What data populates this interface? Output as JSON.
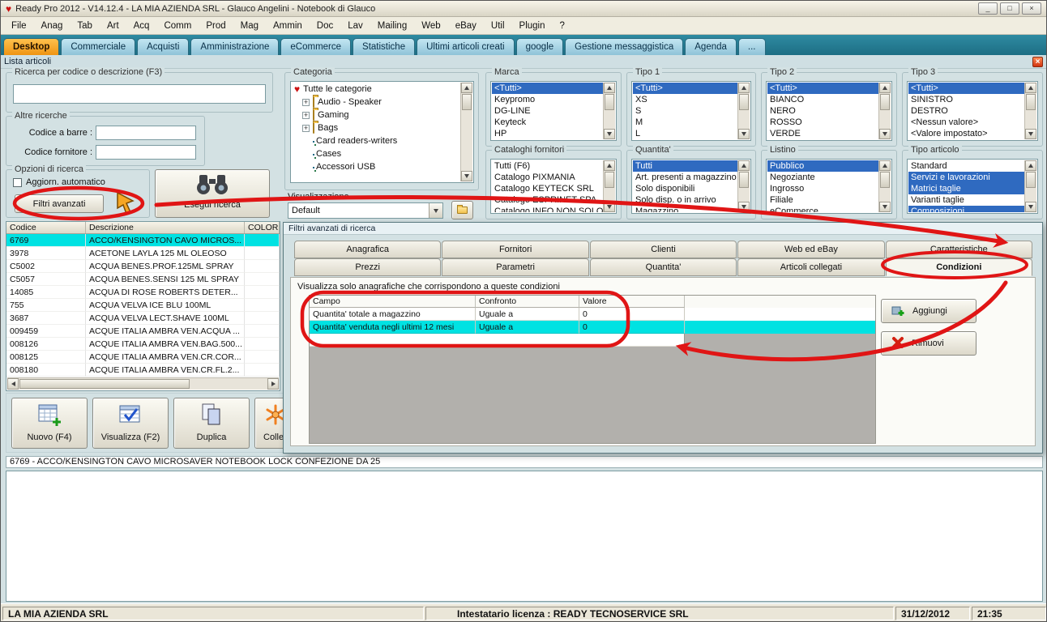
{
  "window": {
    "title": "Ready Pro 2012 - V14.12.4 - LA MIA AZIENDA SRL - Glauco Angelini - Notebook di Glauco"
  },
  "icons": {
    "heart": "♥",
    "minimize": "_",
    "restore": "□",
    "close": "×",
    "plus": "+"
  },
  "colors": {
    "accent_orange": "#ef9413",
    "selection_blue": "#2f6ac0",
    "highlight_cyan": "#00e2e2",
    "annotation_red": "#e01515"
  },
  "menubar": {
    "items": [
      "File",
      "Anag",
      "Tab",
      "Art",
      "Acq",
      "Comm",
      "Prod",
      "Mag",
      "Ammin",
      "Doc",
      "Lav",
      "Mailing",
      "Web",
      "eBay",
      "Util",
      "Plugin",
      "?"
    ]
  },
  "tabbar": {
    "tabs": [
      {
        "label": "Desktop",
        "active": true
      },
      {
        "label": "Commerciale"
      },
      {
        "label": "Acquisti"
      },
      {
        "label": "Amministrazione"
      },
      {
        "label": "eCommerce"
      },
      {
        "label": "Statistiche"
      },
      {
        "label": "Ultimi articoli creati"
      },
      {
        "label": "google"
      },
      {
        "label": "Gestione messaggistica"
      },
      {
        "label": "Agenda"
      },
      {
        "label": "..."
      }
    ]
  },
  "lista_bar": {
    "title": "Lista articoli"
  },
  "search": {
    "group_title": "Ricerca per codice o descrizione (F3)",
    "value": "",
    "altre_title": "Altre ricerche",
    "barcode_label": "Codice a barre :",
    "barcode_value": "",
    "supplier_label": "Codice fornitore :",
    "supplier_value": "",
    "opzioni_title": "Opzioni di ricerca",
    "auto_check_label": "Aggiorn. automatico",
    "filtri_button": "Filtri avanzati",
    "esegui_button": "Esegui ricerca"
  },
  "categoria": {
    "title": "Categoria",
    "items": [
      {
        "label": "Tutte le categorie",
        "icon": "heart",
        "indent": 0
      },
      {
        "label": "Audio - Speaker",
        "icon": "folder",
        "expand": true,
        "indent": 1
      },
      {
        "label": "Gaming",
        "icon": "folder",
        "expand": true,
        "indent": 1
      },
      {
        "label": "Bags",
        "icon": "folder",
        "expand": true,
        "indent": 1
      },
      {
        "label": "Card readers-writers",
        "icon": "cards",
        "indent": 1
      },
      {
        "label": "Cases",
        "icon": "cards",
        "indent": 1
      },
      {
        "label": "Accessori USB",
        "icon": "cards",
        "indent": 1
      }
    ],
    "visualizzazione_label": "Visualizzazione",
    "visualizzazione_value": "Default"
  },
  "lists": {
    "marca": {
      "title": "Marca",
      "items": [
        {
          "label": "<Tutti>",
          "selected": true
        },
        {
          "label": "Keypromo"
        },
        {
          "label": "DG-LINE"
        },
        {
          "label": "Keyteck"
        },
        {
          "label": "HP"
        }
      ]
    },
    "cataloghi": {
      "title": "Cataloghi fornitori",
      "items": [
        {
          "label": "Tutti (F6)"
        },
        {
          "label": "Catalogo PIXMANIA"
        },
        {
          "label": "Catalogo KEYTECK SRL"
        },
        {
          "label": "Catalogo ESPRINET SPA"
        },
        {
          "label": "Catalogo INFO NON SOLO"
        }
      ]
    },
    "tipo1": {
      "title": "Tipo 1",
      "items": [
        {
          "label": "<Tutti>",
          "selected": true
        },
        {
          "label": "XS"
        },
        {
          "label": "S"
        },
        {
          "label": "M"
        },
        {
          "label": "L"
        }
      ]
    },
    "quantita": {
      "title": "Quantita'",
      "items": [
        {
          "label": "Tutti",
          "selected": true
        },
        {
          "label": "Art. presenti a magazzino"
        },
        {
          "label": "Solo disponibili"
        },
        {
          "label": "Solo disp. o in arrivo"
        },
        {
          "label": "Magazzino"
        }
      ]
    },
    "tipo2": {
      "title": "Tipo 2",
      "items": [
        {
          "label": "<Tutti>",
          "selected": true
        },
        {
          "label": "BIANCO"
        },
        {
          "label": "NERO"
        },
        {
          "label": "ROSSO"
        },
        {
          "label": "VERDE"
        }
      ]
    },
    "listino": {
      "title": "Listino",
      "items": [
        {
          "label": "Pubblico",
          "selected": true
        },
        {
          "label": "Negoziante"
        },
        {
          "label": "Ingrosso"
        },
        {
          "label": "Filiale"
        },
        {
          "label": "eCommerce"
        }
      ]
    },
    "tipo3": {
      "title": "Tipo 3",
      "items": [
        {
          "label": "<Tutti>",
          "selected": true
        },
        {
          "label": "SINISTRO"
        },
        {
          "label": "DESTRO"
        },
        {
          "label": "<Nessun valore>"
        },
        {
          "label": "<Valore impostato>"
        }
      ]
    },
    "tipo_articolo": {
      "title": "Tipo articolo",
      "items": [
        {
          "label": "Standard"
        },
        {
          "label": "Servizi e lavorazioni",
          "selected": true
        },
        {
          "label": "Matrici taglie",
          "selected": true
        },
        {
          "label": "Varianti taglie"
        },
        {
          "label": "Composizioni",
          "selected": true
        }
      ]
    }
  },
  "results": {
    "columns": [
      "Codice",
      "Descrizione",
      "COLORE"
    ],
    "rows": [
      {
        "code": "6769",
        "desc": "ACCO/KENSINGTON CAVO MICROS...",
        "selected": true
      },
      {
        "code": "3978",
        "desc": "ACETONE LAYLA 125 ML OLEOSO"
      },
      {
        "code": "C5002",
        "desc": "ACQUA BENES.PROF.125ML SPRAY"
      },
      {
        "code": "C5057",
        "desc": "ACQUA BENES.SENSI 125 ML SPRAY"
      },
      {
        "code": "14085",
        "desc": "ACQUA DI ROSE ROBERTS DETER..."
      },
      {
        "code": "755",
        "desc": "ACQUA VELVA ICE BLU 100ML"
      },
      {
        "code": "3687",
        "desc": "ACQUA VELVA LECT.SHAVE 100ML"
      },
      {
        "code": "009459",
        "desc": "ACQUE ITALIA AMBRA VEN.ACQUA ..."
      },
      {
        "code": "008126",
        "desc": "ACQUE ITALIA AMBRA VEN.BAG.500..."
      },
      {
        "code": "008125",
        "desc": "ACQUE ITALIA AMBRA VEN.CR.COR..."
      },
      {
        "code": "008180",
        "desc": "ACQUE ITALIA AMBRA VEN.CR.FL.2..."
      }
    ]
  },
  "filter_panel": {
    "title": "Filtri avanzati di ricerca",
    "tabs_row1": [
      {
        "label": "Anagrafica"
      },
      {
        "label": "Fornitori"
      },
      {
        "label": "Clienti"
      },
      {
        "label": "Web ed eBay"
      },
      {
        "label": "Caratteristiche"
      }
    ],
    "tabs_row2": [
      {
        "label": "Prezzi"
      },
      {
        "label": "Parametri"
      },
      {
        "label": "Quantita'"
      },
      {
        "label": "Articoli collegati"
      },
      {
        "label": "Condizioni",
        "active": true
      }
    ],
    "condition_intro": "Visualizza solo anagrafiche che corrispondono a queste condizioni",
    "grid": {
      "columns": [
        "Campo",
        "Confronto",
        "Valore"
      ],
      "rows": [
        {
          "campo": "Quantita' totale a magazzino",
          "confronto": "Uguale a",
          "valore": "0"
        },
        {
          "campo": "Quantita' venduta negli ultimi 12 mesi",
          "confronto": "Uguale a",
          "valore": "0",
          "selected": true
        }
      ]
    },
    "aggiungi_button": "Aggiungi",
    "rimuovi_button": "Rimuovi"
  },
  "toolbar": {
    "buttons": [
      {
        "label": "Nuovo (F4)"
      },
      {
        "label": "Visualizza (F2)"
      },
      {
        "label": "Duplica"
      },
      {
        "label": "Collegam"
      }
    ]
  },
  "detail_bar": {
    "text": "6769 - ACCO/KENSINGTON CAVO MICROSAVER NOTEBOOK LOCK CONFEZIONE DA 25"
  },
  "statusbar": {
    "company": "LA MIA AZIENDA SRL",
    "license": "Intestatario licenza : READY TECNOSERVICE SRL",
    "date": "31/12/2012",
    "time": "21:35"
  }
}
